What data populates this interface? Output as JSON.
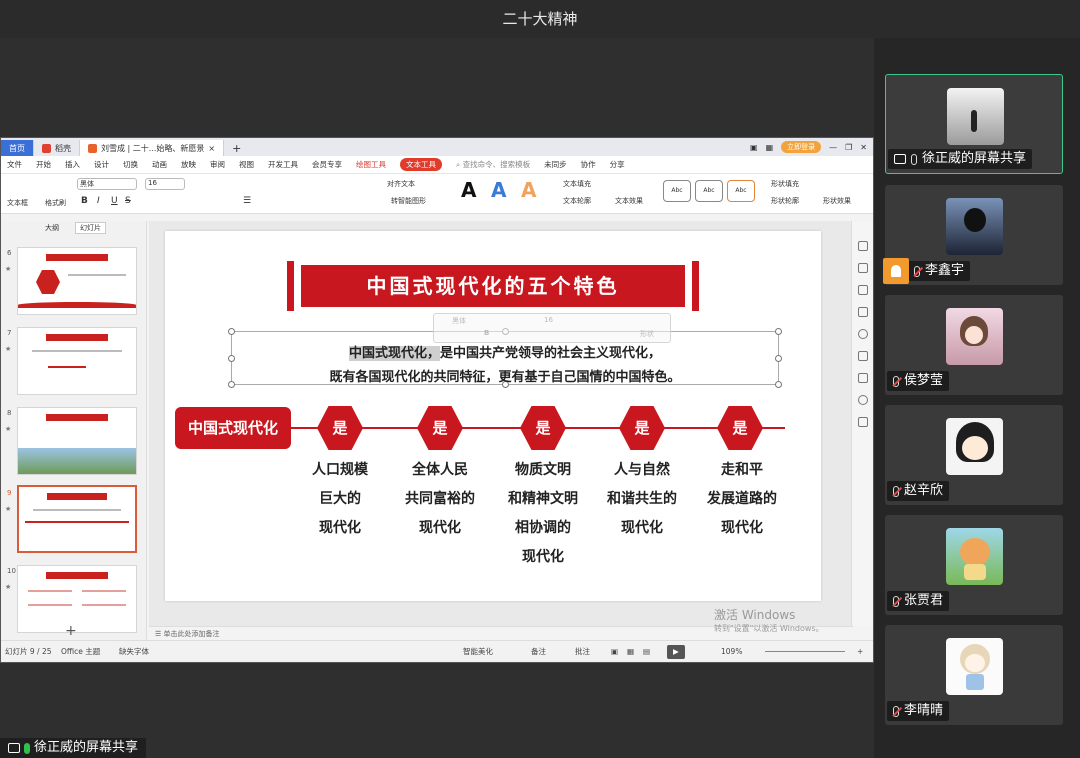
{
  "meeting": {
    "title": "二十大精神"
  },
  "wps": {
    "tabs": [
      {
        "label": "首页"
      },
      {
        "label": "稻壳"
      },
      {
        "label": "刘雪成 | 二十...始略、新愿景"
      }
    ],
    "new_tab": "+",
    "login_label": "立即登录",
    "menu": [
      "文件",
      "开始",
      "插入",
      "设计",
      "切换",
      "动画",
      "放映",
      "审阅",
      "视图",
      "开发工具",
      "会员专享",
      "绘图工具",
      "文本工具"
    ],
    "search_placeholder": "查找命令、搜索模板",
    "menu_right": [
      "未同步",
      "协作",
      "分享"
    ],
    "ribbon": {
      "textbox": "文本框",
      "format_brush": "格式刷",
      "font": "黑体",
      "size": "16",
      "align_text": "对齐文本",
      "smart_shape": "转智能图形",
      "fill_text": "文本填充",
      "outline_text": "文本轮廓",
      "text_effect": "文本效果",
      "shape_fill": "形状填充",
      "shape_outline": "形状轮廓",
      "shape_effect": "形状效果",
      "style_sample": "Abc",
      "big_letter": "A"
    },
    "left_tabs": [
      "大纲",
      "幻灯片"
    ],
    "thumbs": [
      {
        "num": "6",
        "title": "推进高质量发展是首要任务"
      },
      {
        "num": "7",
        "title": "构建新发展格局"
      },
      {
        "num": "8",
        "title": "科教兴国"
      },
      {
        "num": "9",
        "title": "中国式现代化的五个特色"
      },
      {
        "num": "10",
        "title": "中国式现代化本质要求"
      }
    ],
    "add_slide": "+",
    "notes_placeholder": "单击此处添加备注",
    "status": {
      "slide_count": "幻灯片 9 / 25",
      "theme": "Office 主题",
      "missing_font": "缺失字体",
      "beautify": "智能美化",
      "notes": "备注",
      "comments": "批注",
      "zoom": "109%"
    },
    "mini_toolbar": {
      "font": "黑体",
      "size": "16",
      "style": "形状"
    }
  },
  "slide": {
    "title": "中国式现代化的五个特色",
    "desc_line1_sel": "中国式现代化，",
    "desc_line1_rest": "是中国共产党领导的社会主义现代化，",
    "desc_line2": "既有各国现代化的共同特征，更有基于自己国情的中国特色。",
    "main_label": "中国式现代化",
    "hex_label": "是",
    "features": [
      [
        "人口规模",
        "巨大的",
        "现代化"
      ],
      [
        "全体人民",
        "共同富裕的",
        "现代化"
      ],
      [
        "物质文明",
        "和精神文明",
        "相协调的",
        "现代化"
      ],
      [
        "人与自然",
        "和谐共生的",
        "现代化"
      ],
      [
        "走和平",
        "发展道路的",
        "现代化"
      ]
    ]
  },
  "watermark": {
    "line1": "激活 Windows",
    "line2": "转到\"设置\"以激活 Windows。"
  },
  "share_label": "徐正威的屏幕共享",
  "participants": [
    {
      "name": "徐正威的屏幕共享",
      "active": true
    },
    {
      "name": "李鑫宇",
      "host": true
    },
    {
      "name": "侯梦莹"
    },
    {
      "name": "赵辛欣"
    },
    {
      "name": "张贾君"
    },
    {
      "name": "李晴晴"
    }
  ]
}
